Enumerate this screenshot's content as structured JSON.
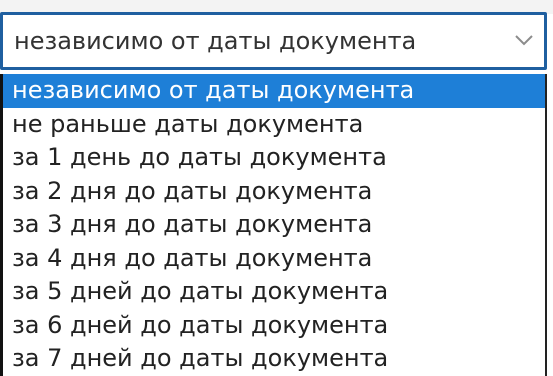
{
  "select": {
    "value": "независимо от даты документа",
    "icon": "chevron-down-icon"
  },
  "options": [
    "независимо от даты документа",
    "не раньше даты документа",
    "за 1 день до даты документа",
    "за 2 дня до даты документа",
    "за 3 дня до даты документа",
    "за 4 дня до даты документа",
    "за 5 дней до даты документа",
    "за 6 дней до даты документа",
    "за 7 дней до даты документа"
  ],
  "selected_index": 0,
  "colors": {
    "highlight": "#1e7fd7",
    "focus_border": "#1f5fa0"
  }
}
